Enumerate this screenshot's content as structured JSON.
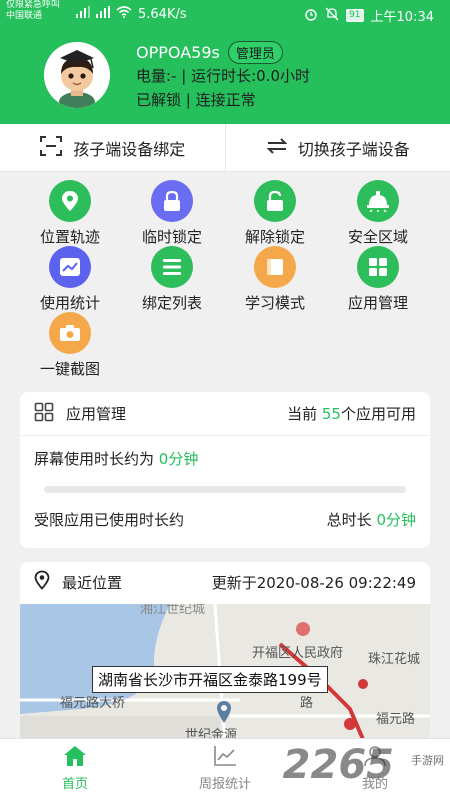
{
  "status_bar": {
    "carrier_line1": "仅限紧急呼叫",
    "carrier_line2": "中国联通",
    "net_speed": "5.64K/s",
    "battery": "91",
    "time": "上午10:34"
  },
  "profile": {
    "device_name": "OPPOA59s",
    "role": "管理员",
    "battery_label": "电量:-",
    "runtime": "运行时长:0.0小时",
    "lock_status": "已解锁",
    "connection": "连接正常"
  },
  "bind_bar": {
    "bind_label": "孩子端设备绑定",
    "switch_label": "切换孩子端设备"
  },
  "features": [
    {
      "label": "位置轨迹",
      "color": "#2ebd5b"
    },
    {
      "label": "临时锁定",
      "color": "#6a6cf2"
    },
    {
      "label": "解除锁定",
      "color": "#2ebd5b"
    },
    {
      "label": "安全区域",
      "color": "#2ebd5b"
    },
    {
      "label": "使用统计",
      "color": "#5b62ee"
    },
    {
      "label": "绑定列表",
      "color": "#2ebd5b"
    },
    {
      "label": "学习模式",
      "color": "#f5a84a"
    },
    {
      "label": "应用管理",
      "color": "#2ebd5b"
    },
    {
      "label": "一键截图",
      "color": "#f5a84a"
    }
  ],
  "app_card": {
    "title": "应用管理",
    "current_prefix": "当前",
    "app_count": "55",
    "current_suffix": "个应用可用",
    "screen_time_label": "屏幕使用时长约为",
    "screen_time_value": "0分钟",
    "restricted_label": "受限应用已使用时长约",
    "total_label": "总时长",
    "total_value": "0分钟"
  },
  "location_card": {
    "title": "最近位置",
    "updated": "更新于2020-08-26 09:22:49",
    "address": "湖南省长沙市开福区金泰路199号",
    "map_labels": {
      "top": "湘江世纪城",
      "gov": "开福区人民政府",
      "garden": "珠江花城",
      "bridge": "福元路大桥",
      "road": "福元路",
      "jinyuan": "世纪金源",
      "road_mark": "路"
    }
  },
  "bottom_nav": {
    "home": "首页",
    "weekly": "周报统计",
    "mine": "我的"
  },
  "watermark": {
    "brand": "2265",
    "sub": "手游网"
  },
  "colors": {
    "primary_green": "#25bf5c"
  }
}
